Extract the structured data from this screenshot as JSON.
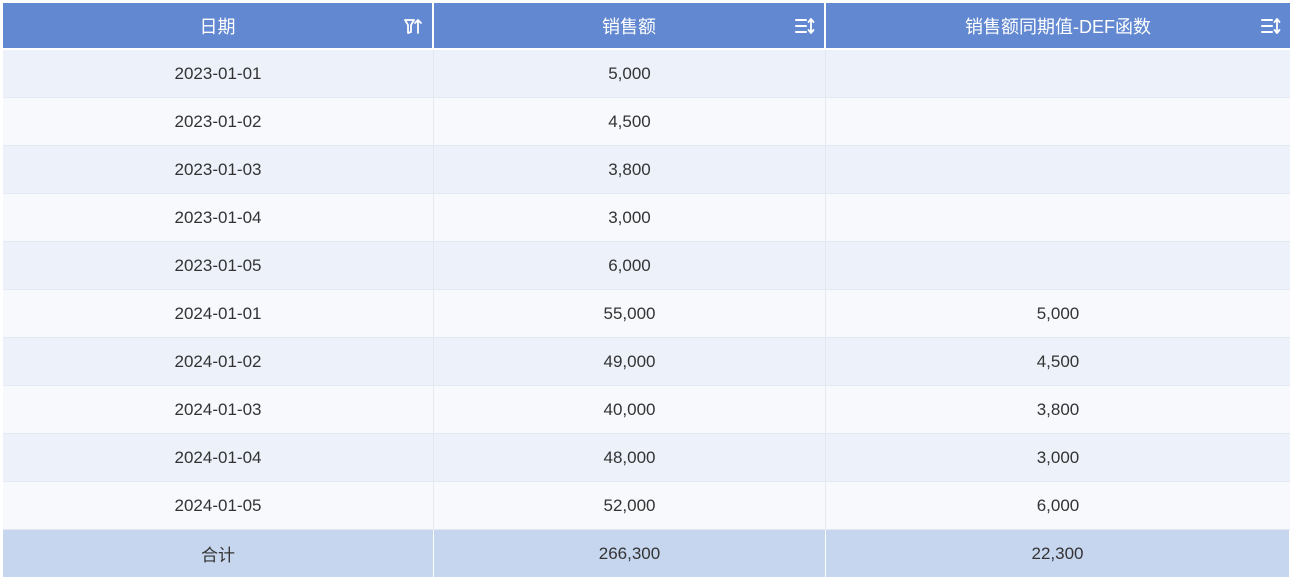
{
  "header": {
    "columns": [
      {
        "label": "日期",
        "icon": "sort-filter-icon"
      },
      {
        "label": "销售额",
        "icon": "sort-icon"
      },
      {
        "label": "销售额同期值-DEF函数",
        "icon": "sort-icon"
      }
    ]
  },
  "rows": [
    {
      "date": "2023-01-01",
      "sales": "5,000",
      "prior": ""
    },
    {
      "date": "2023-01-02",
      "sales": "4,500",
      "prior": ""
    },
    {
      "date": "2023-01-03",
      "sales": "3,800",
      "prior": ""
    },
    {
      "date": "2023-01-04",
      "sales": "3,000",
      "prior": ""
    },
    {
      "date": "2023-01-05",
      "sales": "6,000",
      "prior": ""
    },
    {
      "date": "2024-01-01",
      "sales": "55,000",
      "prior": "5,000"
    },
    {
      "date": "2024-01-02",
      "sales": "49,000",
      "prior": "4,500"
    },
    {
      "date": "2024-01-03",
      "sales": "40,000",
      "prior": "3,800"
    },
    {
      "date": "2024-01-04",
      "sales": "48,000",
      "prior": "3,000"
    },
    {
      "date": "2024-01-05",
      "sales": "52,000",
      "prior": "6,000"
    }
  ],
  "total": {
    "label": "合计",
    "sales": "266,300",
    "prior": "22,300"
  },
  "colors": {
    "header_bg": "#6288d1",
    "row_odd": "#edf2fa",
    "row_even": "#f7f9fd",
    "total_bg": "#c7d6ef"
  }
}
